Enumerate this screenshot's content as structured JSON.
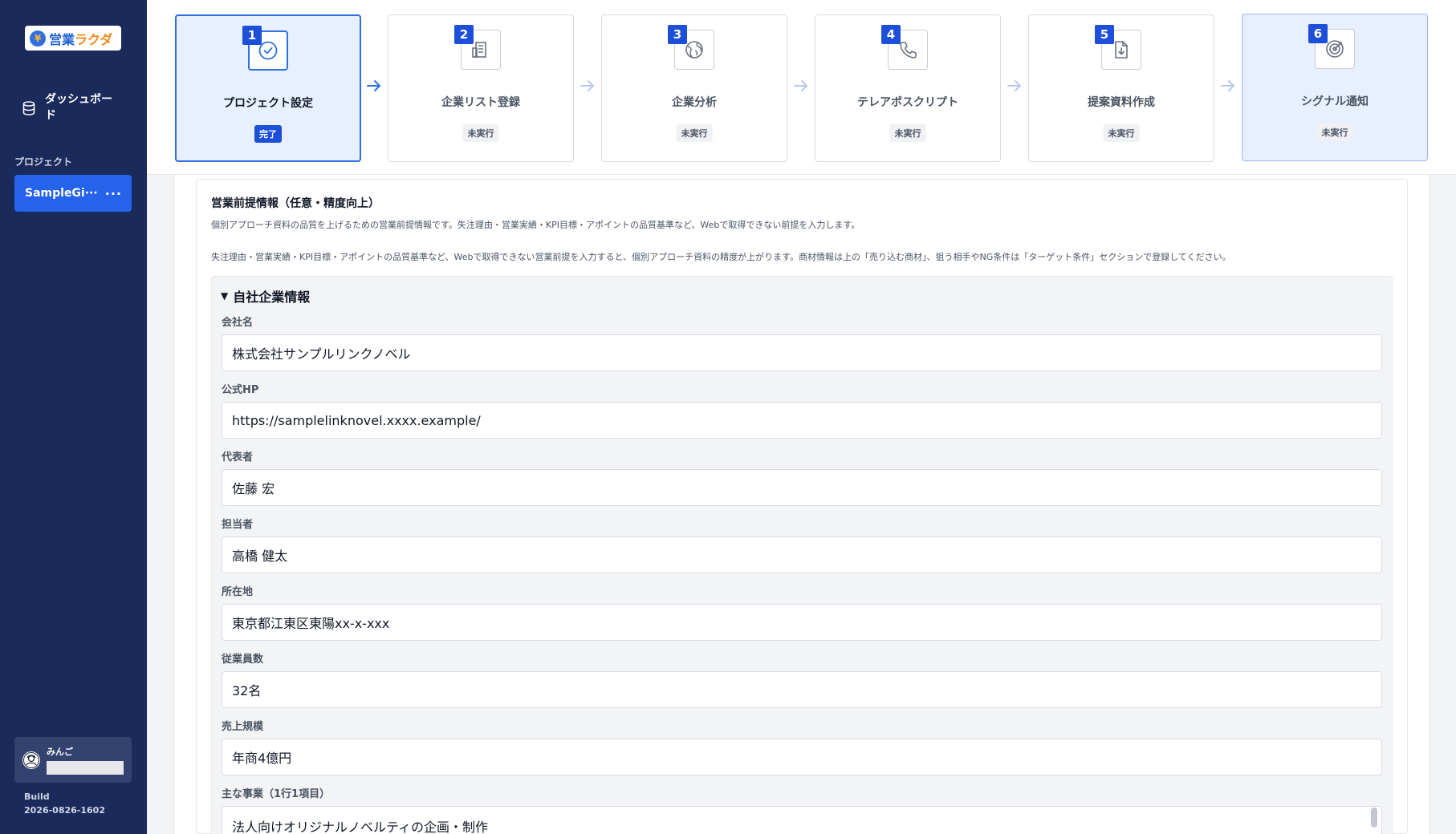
{
  "sidebar": {
    "logo_text_a": "営業",
    "logo_text_b": "ラクダ",
    "dashboard_label": "ダッシュボード",
    "section_label": "プロジェクト",
    "project_name": "SampleGi···",
    "project_more": "···",
    "user_name": "みんご",
    "build_label": "Build",
    "build_number": "2026-0826-1602"
  },
  "steps": [
    {
      "num": "1",
      "title": "プロジェクト設定",
      "status": "完了",
      "icon": "check-circle-icon"
    },
    {
      "num": "2",
      "title": "企業リスト登録",
      "status": "未実行",
      "icon": "building-list-icon"
    },
    {
      "num": "3",
      "title": "企業分析",
      "status": "未実行",
      "icon": "globe-icon"
    },
    {
      "num": "4",
      "title": "テレアポスクリプト",
      "status": "未実行",
      "icon": "phone-icon"
    },
    {
      "num": "5",
      "title": "提案資料作成",
      "status": "未実行",
      "icon": "file-download-icon"
    },
    {
      "num": "6",
      "title": "シグナル通知",
      "status": "未実行",
      "icon": "target-icon"
    }
  ],
  "section": {
    "title": "営業前提情報（任意・精度向上）",
    "description": "個別アプローチ資料の品質を上げるための営業前提情報です。失注理由・営業実績・KPI目標・アポイントの品質基準など、Webで取得できない前提を入力します。",
    "note": "失注理由・営業実績・KPI目標・アポイントの品質基準など、Webで取得できない営業前提を入力すると、個別アプローチ資料の精度が上がります。商材情報は上の「売り込む商材」、狙う相手やNG条件は「ターゲット条件」セクションで登録してください。"
  },
  "company": {
    "toggle_label": "自社企業情報",
    "fields": [
      {
        "label": "会社名",
        "value": "株式会社サンプルリンクノベル"
      },
      {
        "label": "公式HP",
        "value": "https://samplelinknovel.xxxx.example/"
      },
      {
        "label": "代表者",
        "value": "佐藤 宏"
      },
      {
        "label": "担当者",
        "value": "高橋 健太"
      },
      {
        "label": "所在地",
        "value": "東京都江東区東陽xx-x-xxx"
      },
      {
        "label": "従業員数",
        "value": "32名"
      },
      {
        "label": "売上規模",
        "value": "年商4億円"
      }
    ],
    "main_business_label": "主な事業（1行1項目）",
    "main_business_value": "法人向けオリジナルノベルティの企画・制作"
  },
  "colors": {
    "sidebar_bg": "#1a2a5b",
    "accent": "#2563eb",
    "step_active_bg": "#e8efff"
  }
}
